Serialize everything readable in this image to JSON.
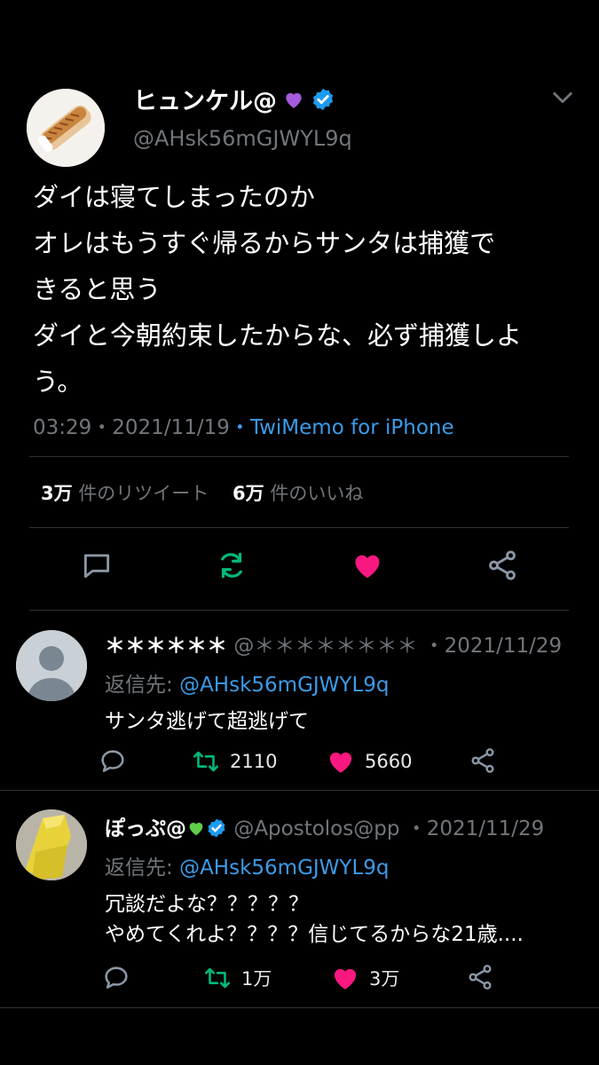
{
  "tweet": {
    "author_name": "ヒュンケル@",
    "handle": "@AHsk56mGJWYL9q",
    "text": "ダイは寝てしまったのか\nオレはもうすぐ帰るからサンタは捕獲で\nきると思う\nダイと今朝約束したからな、必ず捕獲しよ\nう。",
    "time": "03:29・2021/11/19",
    "source": "・TwiMemo for iPhone",
    "retweet_count": "3万",
    "retweet_label": "件のリツイート",
    "like_count": "6万",
    "like_label": "件のいいね"
  },
  "replies": [
    {
      "name": "＊＊＊＊＊＊",
      "handle": "@＊＊＊＊＊＊＊＊",
      "date": "・2021/11/29",
      "reply_prefix": "返信先: ",
      "reply_to": "@AHsk56mGJWYL9q",
      "text": "サンタ逃げて超逃げて",
      "retweets": "2110",
      "likes": "5660"
    },
    {
      "name": "ぽっぷ@",
      "handle": "@Apostolos@pp",
      "date": "・2021/11/29",
      "reply_prefix": "返信先: ",
      "reply_to": "@AHsk56mGJWYL9q",
      "text": "冗談だよな？？？？？\nやめてくれよ？？？？信じてるからな21歳....",
      "retweets": "1万",
      "likes": "3万"
    }
  ],
  "colors": {
    "background": "#000000",
    "link": "#3c9be8",
    "like_pink": "#f91880",
    "retweet_green": "#00ba7c",
    "verified": "#1d9bf0"
  },
  "icons": [
    "purple-heart-icon",
    "verified-badge-icon",
    "chevron-down-icon",
    "reply-icon",
    "retweet-icon",
    "like-icon",
    "share-icon",
    "default-avatar-icon",
    "green-heart-icon"
  ]
}
